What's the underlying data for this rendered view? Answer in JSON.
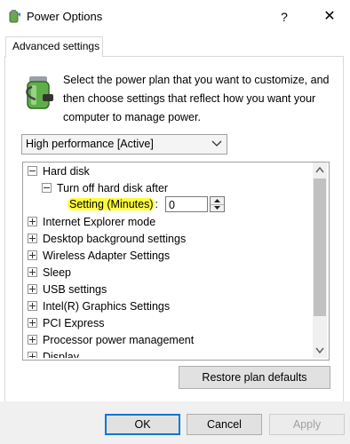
{
  "window": {
    "title": "Power Options",
    "help_label": "?",
    "close_label": "✕"
  },
  "tabs": [
    {
      "label": "Advanced settings"
    }
  ],
  "intro_text": "Select the power plan that you want to customize, and then choose settings that reflect how you want your computer to manage power.",
  "plan_select": {
    "value": "High performance [Active]"
  },
  "tree": {
    "hard_disk": "Hard disk",
    "turn_off": "Turn off hard disk after",
    "setting_label": "Setting (Minutes)",
    "colon": ":",
    "setting_value": "0",
    "items": [
      "Internet Explorer mode",
      "Desktop background settings",
      "Wireless Adapter Settings",
      "Sleep",
      "USB settings",
      "Intel(R) Graphics Settings",
      "PCI Express",
      "Processor power management",
      "Display"
    ]
  },
  "buttons": {
    "restore": "Restore plan defaults",
    "ok": "OK",
    "cancel": "Cancel",
    "apply": "Apply"
  },
  "colors": {
    "highlight": "#fffd3a",
    "focus_border": "#0078d7"
  }
}
